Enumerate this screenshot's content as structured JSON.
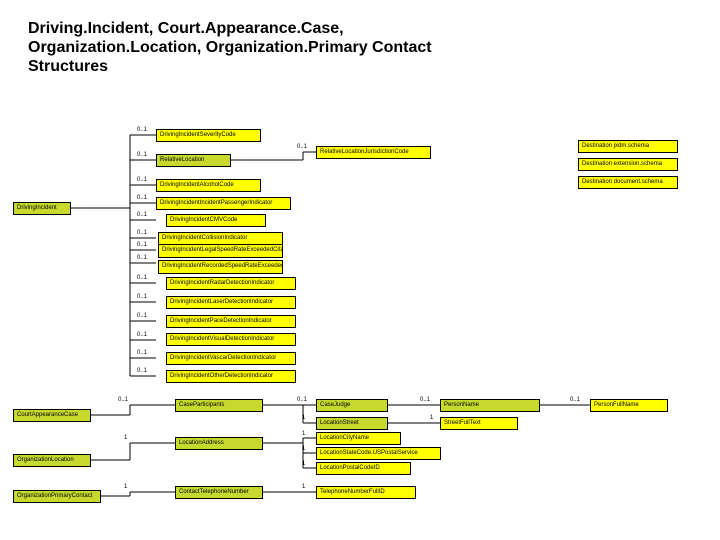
{
  "title": "Driving.Incident, Court.Appearance.Case, Organization.Location, Organization.Primary Contact Structures",
  "nodes": {
    "drivingIncident": "DrivingIncident",
    "courtAppearanceCase": "CourtAppearanceCase",
    "organizationLocation": "OrganizationLocation",
    "organizationPrimaryContact": "OrganizationPrimaryContact",
    "severityCode": "DrivingIncidentSeverityCode",
    "relativeLocation": "RelativeLocation",
    "relLocJurisCode": "RelativeLocationJurisdictionCode",
    "alcoholCode": "DrivingIncidentAlcoholCode",
    "passengerInd": "DrivingIncidentIncidentPassengerIndicator",
    "cmvCode": "DrivingIncidentCMVCode",
    "collisionInd": "DrivingIncidentCollisionIndicator",
    "legalSpeed": "DrivingIncidentLegalSpeedRateExceededCitationCode",
    "recordedSpeed": "DrivingIncidentRecordedSpeedRateExceededCitationCode",
    "radarInd": "DrivingIncidentRadarDetectionIndicator",
    "laserInd": "DrivingIncidentLaserDetectionIndicator",
    "paceInd": "DrivingIncidentPaceDetectionIndicator",
    "visualInd": "DrivingIncidentVisualDetectionIndicator",
    "vascarInd": "DrivingIncidentVascarDetectionIndicator",
    "otherInd": "DrivingIncidentOtherDetectionIndicator",
    "caseParticipants": "CaseParticipants",
    "caseJudge": "CaseJudge",
    "personName": "PersonName",
    "personFullName": "PersonFullName",
    "locationStreet": "LocationStreet",
    "streetFullText": "StreetFullText",
    "locationAddress": "LocationAddress",
    "locationCityName": "LocationCityName",
    "locationStateCode": "LocationStateCode.USPostalService",
    "locationPostalCode": "LocationPostalCodeID",
    "contactTelephone": "ContactTelephoneNumber",
    "telephoneFull": "TelephoneNumberFullID",
    "destJxdm": "Destination jxdm.schema",
    "destExt": "Destination extension.schema",
    "destDoc": "Destination document.schema"
  },
  "cards": {
    "c01": "0..1",
    "c1": "1"
  }
}
